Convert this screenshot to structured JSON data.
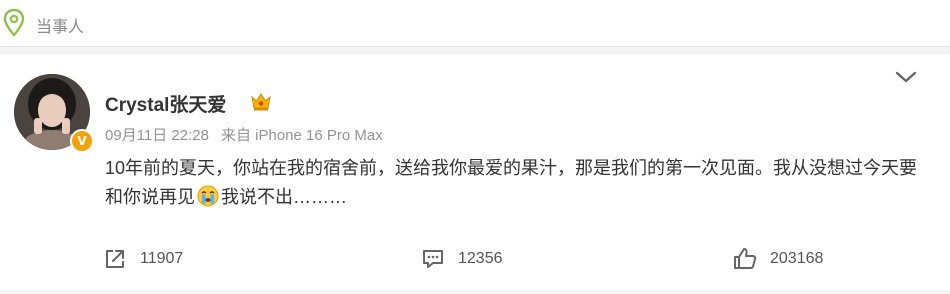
{
  "header": {
    "label": "当事人"
  },
  "post": {
    "username": "Crystal张天爱",
    "date": "09月11日 22:28",
    "source": "来自 iPhone 16 Pro Max",
    "content_part1": "10年前的夏天，你站在我的宿舍前，送给我你最爱的果汁，那是我们的第一次见面。我从没想过今天要和你说再见",
    "content_part2": "我说不出………",
    "verified_badge": "V"
  },
  "actions": {
    "share_count": "11907",
    "comment_count": "12356",
    "like_count": "203168"
  },
  "colors": {
    "pin_green": "#8bc34a",
    "verified_orange": "#f0a30a",
    "crown_gold": "#f4b400"
  },
  "icons": [
    "location-pin-icon",
    "crown-icon",
    "chevron-down-icon",
    "share-icon",
    "comment-icon",
    "like-icon",
    "crying-emoji-icon"
  ]
}
